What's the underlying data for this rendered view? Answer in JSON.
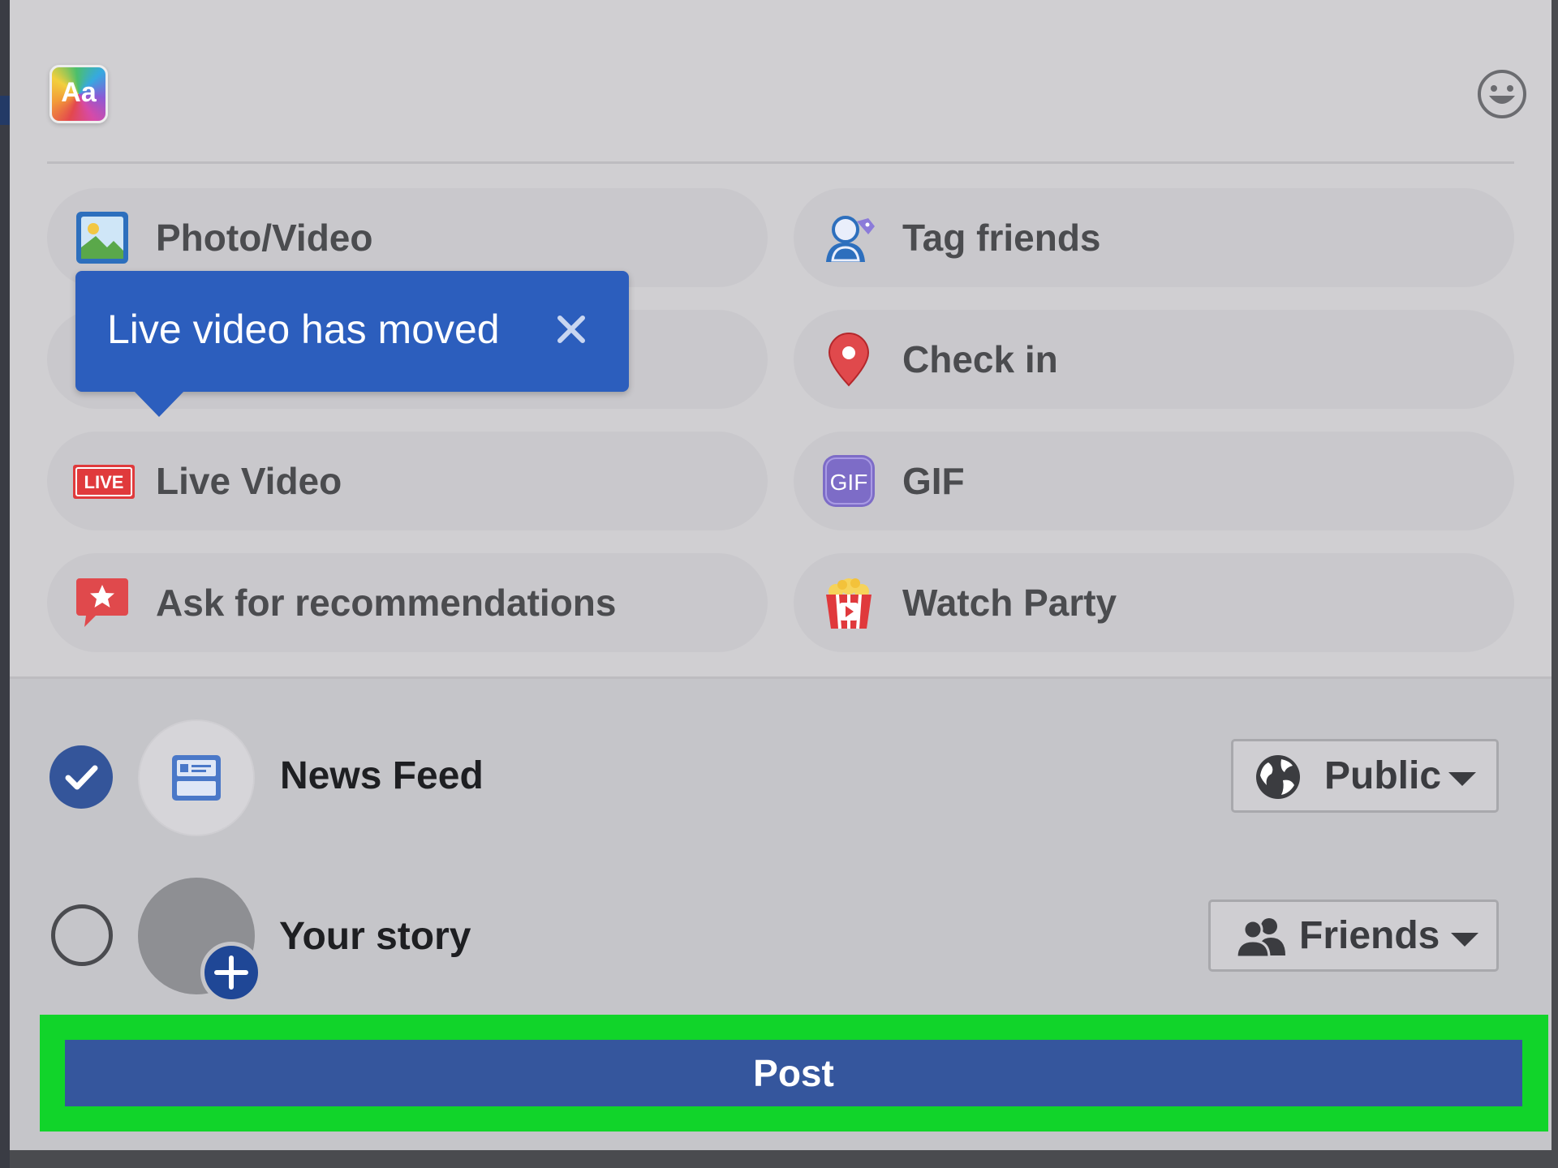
{
  "composer": {
    "text_style_icon": "text-style-icon",
    "text_style_label": "Aa",
    "emoji_icon": "smiley-icon"
  },
  "options": [
    {
      "label": "Photo/Video",
      "icon": "photo-icon"
    },
    {
      "label": "Tag friends",
      "icon": "tag-friends-icon"
    },
    {
      "label": "",
      "icon": "hidden-option-icon"
    },
    {
      "label": "Check in",
      "icon": "location-pin-icon"
    },
    {
      "label": "Live Video",
      "icon": "live-icon"
    },
    {
      "label": "GIF",
      "icon": "gif-icon"
    },
    {
      "label": "Ask for recommendations",
      "icon": "recommendation-icon"
    },
    {
      "label": "Watch Party",
      "icon": "popcorn-icon"
    }
  ],
  "live_badge_text": "LIVE",
  "gif_badge_text": "GIF",
  "tooltip": {
    "text": "Live video has moved",
    "close_symbol": "×"
  },
  "destinations": [
    {
      "label": "News Feed",
      "checked": true,
      "audience": "Public",
      "audience_icon": "globe-icon"
    },
    {
      "label": "Your story",
      "checked": false,
      "audience": "Friends",
      "audience_icon": "friends-icon"
    }
  ],
  "post_button_label": "Post",
  "colors": {
    "accent_blue": "#35569d",
    "tooltip_blue": "#2c5ebd",
    "highlight_green": "#11d42a",
    "live_red": "#e03a3c"
  }
}
